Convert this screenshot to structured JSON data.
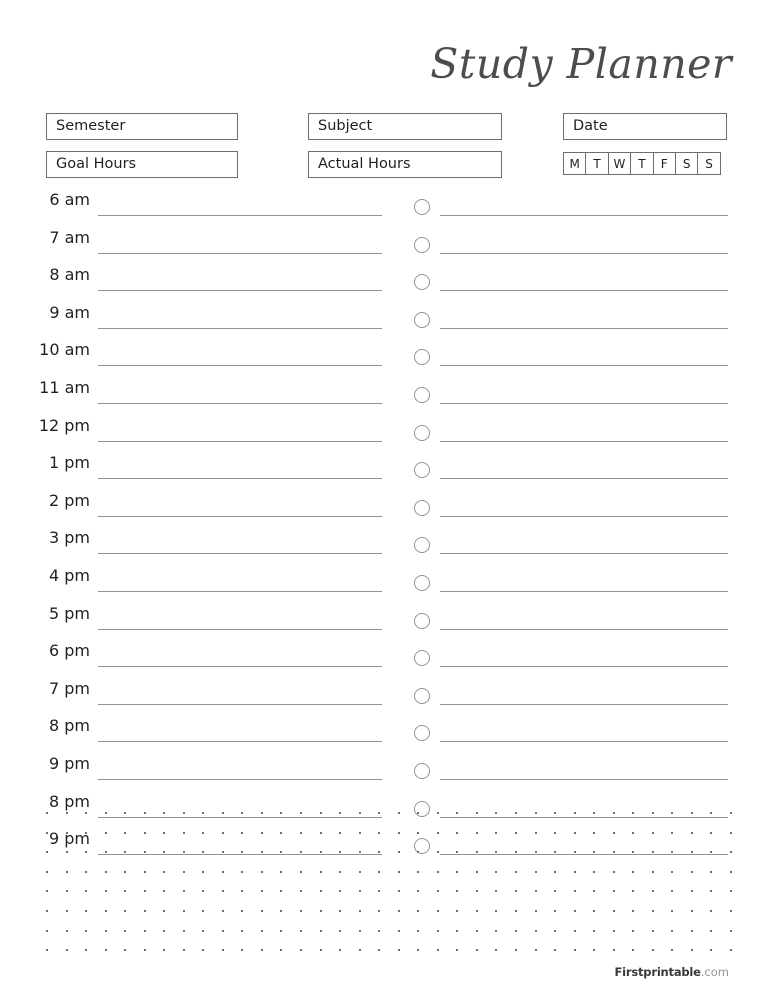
{
  "header": {
    "title": "Study Planner"
  },
  "fields": [
    {
      "name": "semester",
      "label": "Semester"
    },
    {
      "name": "goal-hours",
      "label": "Goal Hours"
    },
    {
      "name": "subject",
      "label": "Subject"
    },
    {
      "name": "actual-hours",
      "label": "Actual Hours"
    },
    {
      "name": "date",
      "label": "Date"
    }
  ],
  "days": [
    "M",
    "T",
    "W",
    "T",
    "F",
    "S",
    "S"
  ],
  "schedule": {
    "rows": [
      {
        "time": "6 am"
      },
      {
        "time": "7 am"
      },
      {
        "time": "8 am"
      },
      {
        "time": "9 am"
      },
      {
        "time": "10 am"
      },
      {
        "time": "11 am"
      },
      {
        "time": "12 pm"
      },
      {
        "time": "1 pm"
      },
      {
        "time": "2 pm"
      },
      {
        "time": "3 pm"
      },
      {
        "time": "4 pm"
      },
      {
        "time": "5 pm"
      },
      {
        "time": "6 pm"
      },
      {
        "time": "7 pm"
      },
      {
        "time": "8 pm"
      },
      {
        "time": "9 pm"
      },
      {
        "time": "8 pm"
      },
      {
        "time": "9 pm"
      }
    ]
  },
  "notes": {
    "dot_rows": 8,
    "dot_columns": 36
  },
  "footer": {
    "brand": "Firstprintable",
    "tld": ".com"
  },
  "colors": {
    "ink": "#231f20",
    "title": "#4d4d4f",
    "rule": "#929497",
    "box_border": "#6d6e71",
    "dot": "#6d6e71",
    "background": "#ffffff"
  }
}
